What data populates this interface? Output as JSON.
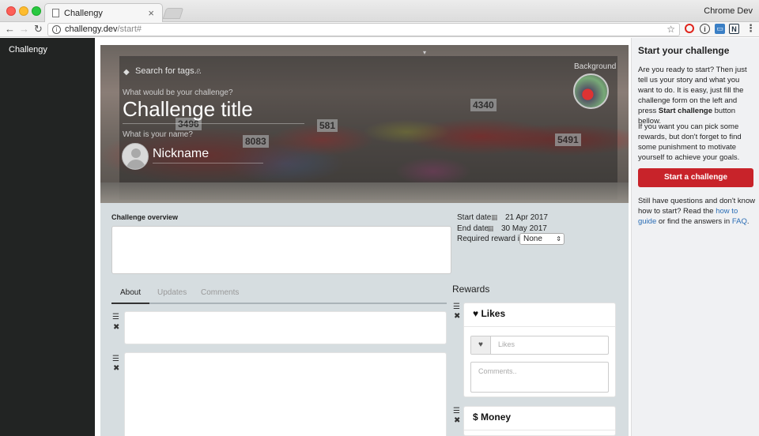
{
  "browser": {
    "tab_title": "Challengy",
    "tab_close": "×",
    "profile": "Chrome Dev",
    "url_host": "challengy.dev",
    "url_path": "/start#"
  },
  "nav": {
    "brand": "Challengy"
  },
  "hero": {
    "search_placeholder": "Search for tags...",
    "background_label": "Background",
    "challenge_question": "What would be your challenge?",
    "challenge_title": "Challenge title",
    "name_question": "What is your name?",
    "nickname": "Nickname"
  },
  "form": {
    "overview_label": "Challenge overview",
    "start_label": "Start date",
    "start_date": "21 Apr 2017",
    "end_label": "End date",
    "end_date": "30 May 2017",
    "reward_label": "Required reward is",
    "reward_value": "None"
  },
  "tabs": {
    "about": "About",
    "updates": "Updates",
    "comments": "Comments"
  },
  "rewards": {
    "heading": "Rewards",
    "likes_title": "Likes",
    "likes_placeholder": "Likes",
    "comments_placeholder": "Comments..",
    "money_title": "Money"
  },
  "sidebar": {
    "title": "Start your challenge",
    "p1_a": "Are you ready to start? Then just tell us your story and what you want to do. It is easy, just fill the challenge form on the left and press",
    "p1_bold": "Start challenge",
    "p1_b": "button bellow.",
    "p2": "If you want you can pick some rewards, but don't forget to find some punishment to motivate yourself to achieve your goals.",
    "button": "Start a challenge",
    "p3_a": "Still have questions and don't know how to start? Read the",
    "p3_link1": "how to guide",
    "p3_b": "or find the answers in",
    "p3_link2": "FAQ",
    "p3_end": "."
  },
  "colors": {
    "accent_red": "#c8232a",
    "link_blue": "#2a6db5",
    "nav_dark": "#222423"
  }
}
